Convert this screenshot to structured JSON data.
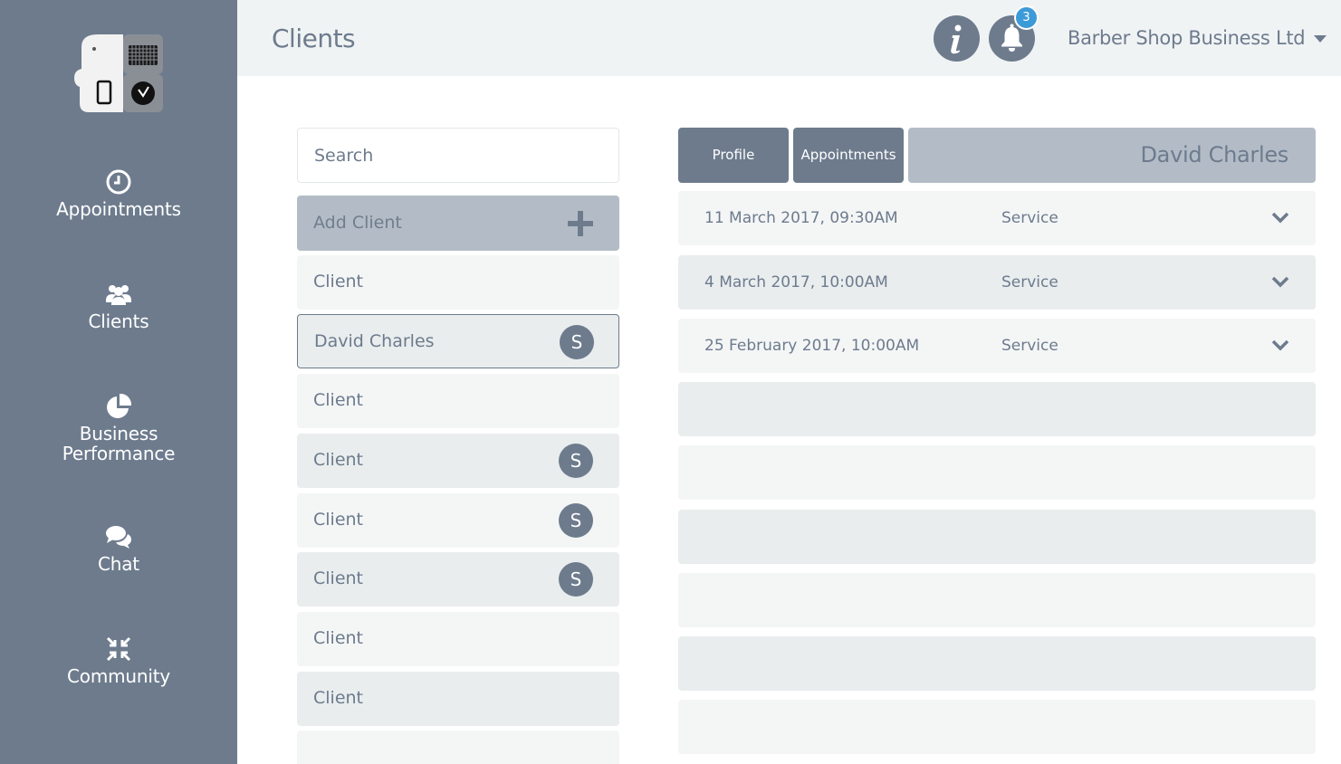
{
  "sidebar": {
    "nav": [
      {
        "label": "Appointments",
        "icon": "clock-icon"
      },
      {
        "label": "Clients",
        "icon": "users-icon"
      },
      {
        "label_line1": "Business",
        "label_line2": "Performance",
        "icon": "pie-chart-icon"
      },
      {
        "label": "Chat",
        "icon": "chat-bubbles-icon"
      },
      {
        "label": "Community",
        "icon": "compress-arrows-icon"
      }
    ]
  },
  "header": {
    "title": "Clients",
    "notifications_count": "3",
    "business_name": "Barber Shop Business Ltd"
  },
  "client_list": {
    "search_placeholder": "Search",
    "add_client_label": "Add Client",
    "clients": [
      {
        "name": "Client",
        "badge": ""
      },
      {
        "name": "David Charles",
        "badge": "S"
      },
      {
        "name": "Client",
        "badge": ""
      },
      {
        "name": "Client",
        "badge": "S"
      },
      {
        "name": "Client",
        "badge": "S"
      },
      {
        "name": "Client",
        "badge": "S"
      },
      {
        "name": "Client",
        "badge": ""
      },
      {
        "name": "Client",
        "badge": ""
      }
    ]
  },
  "detail": {
    "tabs": {
      "profile": "Profile",
      "appointments": "Appointments"
    },
    "selected_client": "David Charles",
    "appointments": [
      {
        "date": "11 March 2017, 09:30AM",
        "service": "Service"
      },
      {
        "date": "4 March 2017, 10:00AM",
        "service": "Service"
      },
      {
        "date": "25 February 2017, 10:00AM",
        "service": "Service"
      }
    ]
  },
  "colors": {
    "sidebar": "#6d7b8d",
    "header_bg": "#f0f3f4",
    "accent_badge": "#3d9ad8",
    "add_client_bg": "#b3bcc6"
  }
}
